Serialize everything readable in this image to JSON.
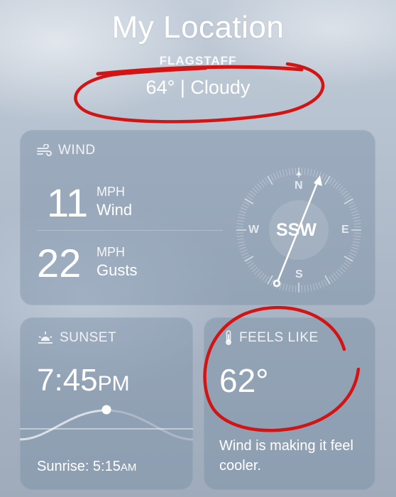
{
  "header": {
    "title": "My Location",
    "city": "FLAGSTAFF",
    "summary": "64° | Cloudy"
  },
  "wind": {
    "label": "WIND",
    "wind_value": "11",
    "wind_unit": "MPH",
    "wind_text": "Wind",
    "gust_value": "22",
    "gust_unit": "MPH",
    "gust_text": "Gusts",
    "direction": "SSW",
    "cardinals": {
      "n": "N",
      "e": "E",
      "s": "S",
      "w": "W"
    }
  },
  "sunset": {
    "label": "SUNSET",
    "time": "7:45",
    "time_ampm": "PM",
    "sunrise_label": "Sunrise: 5:15",
    "sunrise_ampm": "AM"
  },
  "feels_like": {
    "label": "FEELS LIKE",
    "value": "62°",
    "description": "Wind is making it feel cooler."
  },
  "colors": {
    "annotation": "#d21414",
    "card": "#788ca5"
  }
}
